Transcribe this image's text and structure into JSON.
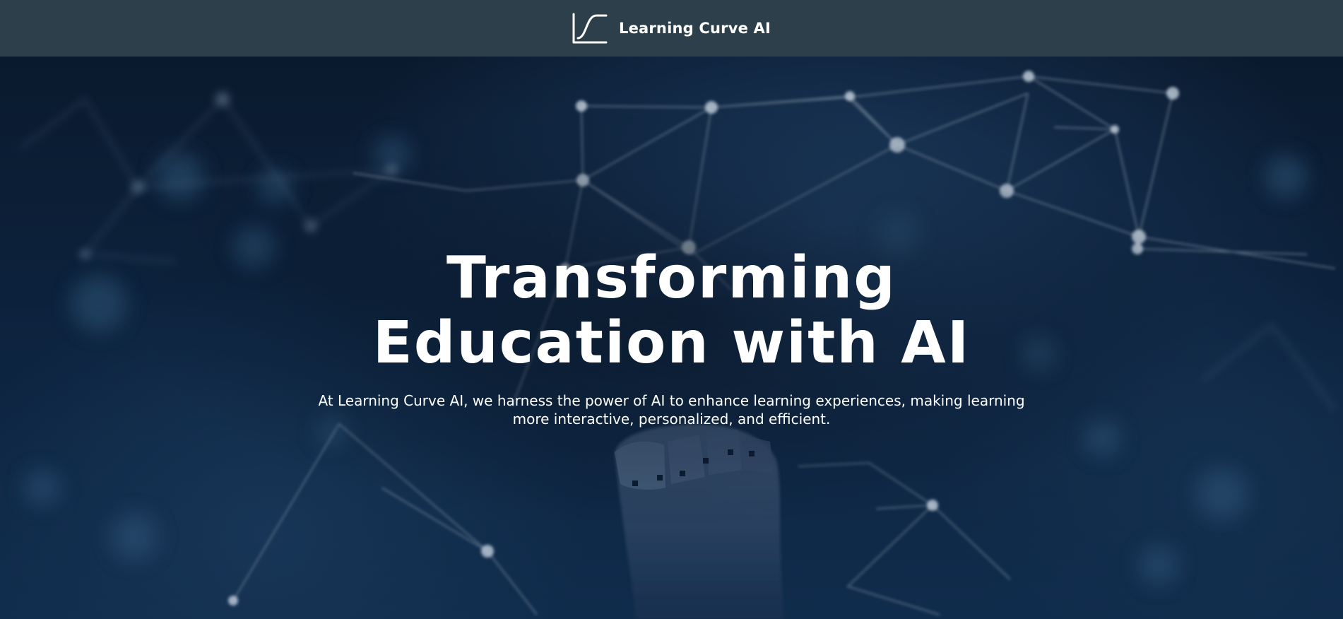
{
  "header": {
    "brand_name": "Learning Curve AI",
    "logo_icon": "learning-curve-icon"
  },
  "hero": {
    "title_line_1": "Transforming",
    "title_line_2": "Education with AI",
    "subtitle": "At Learning Curve AI, we harness the power of AI to enhance learning experiences, making learning more interactive, personalized, and efficient.",
    "background_image": "robotic-hand-neural-network-image"
  },
  "colors": {
    "header_background": "#2c3f4a",
    "hero_background": "#0d2440",
    "text": "#ffffff",
    "network_lines": "#a9b8c6"
  }
}
